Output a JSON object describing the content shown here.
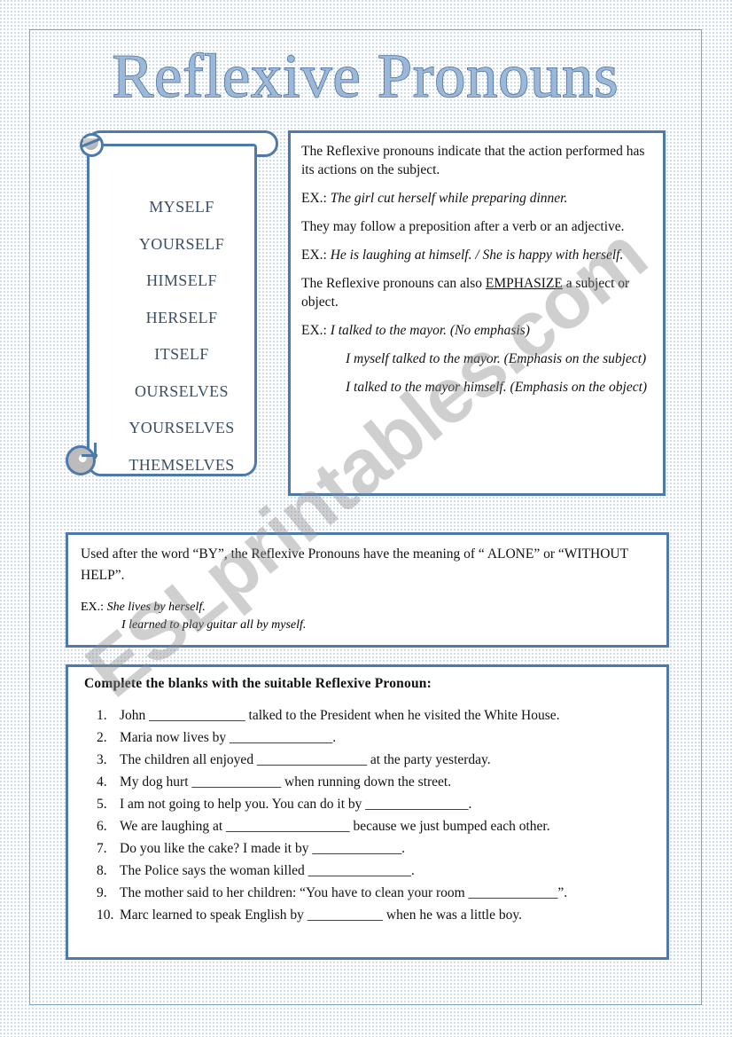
{
  "title": "Reflexive Pronouns",
  "watermark": "ESLprintables.com",
  "colors": {
    "accent_border": "#4d7aab",
    "title_fill": "#9cb8d8",
    "title_outline": "#4a6f9c",
    "pronoun_text": "#3c4e63",
    "page_frame": "#7ea5c4",
    "paper_dots": "#c3d3e6"
  },
  "scroll": {
    "pronouns": [
      "MYSELF",
      "YOURSELF",
      "HIMSELF",
      "HERSELF",
      "ITSELF",
      "OURSELVES",
      "YOURSELVES",
      "THEMSELVES"
    ]
  },
  "explanation": {
    "paragraphs": [
      "The Reflexive pronouns indicate that the action performed has its actions on the subject.",
      "They may follow a preposition after a verb or an adjective."
    ],
    "ex1_label": "EX.: ",
    "ex1_text": "The girl cut herself while preparing dinner.",
    "ex2_label": "EX.: ",
    "ex2_text": "He is laughing at himself. / She is happy with herself.",
    "emphasize_pre": "The Reflexive pronouns can also ",
    "emphasize_word": "EMPHASIZE",
    "emphasize_post": " a subject or object.",
    "ex3_label": "EX.: ",
    "ex3_text": "I talked to the mayor. (No emphasis)",
    "ex4_text": "I myself talked to the mayor. (Emphasis on the subject)",
    "ex5_text": "I talked to the mayor himself. (Emphasis on the object)"
  },
  "by_box": {
    "intro": "Used after the word “BY”, the Reflexive Pronouns have the meaning of “ ALONE” or “WITHOUT HELP”.",
    "ex_label": "EX.:  ",
    "ex_line1": "She lives by herself.",
    "ex_line2": "I learned to play guitar all by myself."
  },
  "exercise": {
    "heading": "Complete the blanks with the suitable Reflexive Pronoun:",
    "items": [
      {
        "number": "1.",
        "text": "John ______________ talked to the President when he visited the White House."
      },
      {
        "number": "2.",
        "text": "Maria now lives by _______________."
      },
      {
        "number": "3.",
        "text": "The children all enjoyed ________________ at the party yesterday."
      },
      {
        "number": "4.",
        "text": "My dog hurt _____________ when running down the street."
      },
      {
        "number": "5.",
        "text": "I am not going to help you. You can do it by _______________."
      },
      {
        "number": "6.",
        "text": "We are laughing at __________________ because we just bumped each other."
      },
      {
        "number": "7.",
        "text": "Do you like the cake? I made it by _____________."
      },
      {
        "number": "8.",
        "text": "The Police says the woman killed _______________."
      },
      {
        "number": "9.",
        "text": "The mother said to her children: “You have to clean your room _____________”."
      },
      {
        "number": "10.",
        "text": "Marc learned to speak English by ___________ when he was a little boy."
      }
    ]
  }
}
